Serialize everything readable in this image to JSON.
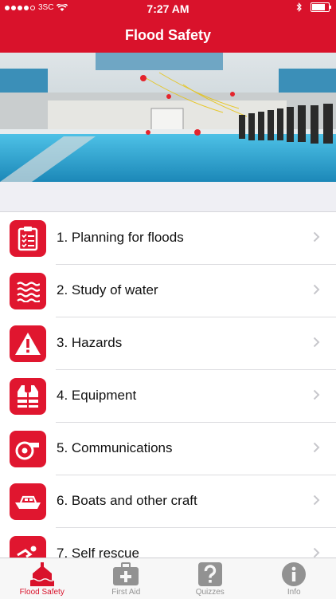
{
  "status": {
    "carrier": "3SC",
    "time": "7:27 AM",
    "battery_level": 0.9
  },
  "nav": {
    "title": "Flood Safety"
  },
  "hero": {
    "icon": "pool-rescue-photo"
  },
  "items": [
    {
      "label": "1. Planning for floods",
      "icon": "clipboard-checklist-icon"
    },
    {
      "label": "2. Study of water",
      "icon": "waves-icon"
    },
    {
      "label": "3. Hazards",
      "icon": "warning-triangle-icon"
    },
    {
      "label": "4. Equipment",
      "icon": "life-jacket-icon"
    },
    {
      "label": "5. Communications",
      "icon": "whistle-icon"
    },
    {
      "label": "6. Boats and other craft",
      "icon": "boat-icon"
    },
    {
      "label": "7. Self rescue",
      "icon": "swimmer-icon"
    }
  ],
  "tabs": [
    {
      "label": "Flood Safety",
      "icon": "flood-house-icon",
      "active": true
    },
    {
      "label": "First Aid",
      "icon": "first-aid-kit-icon",
      "active": false
    },
    {
      "label": "Quizzes",
      "icon": "question-mark-icon",
      "active": false
    },
    {
      "label": "Info",
      "icon": "info-icon",
      "active": false
    }
  ],
  "colors": {
    "brand": "#d9122b",
    "icon_bg": "#e0162f",
    "tab_inactive": "#929292"
  }
}
